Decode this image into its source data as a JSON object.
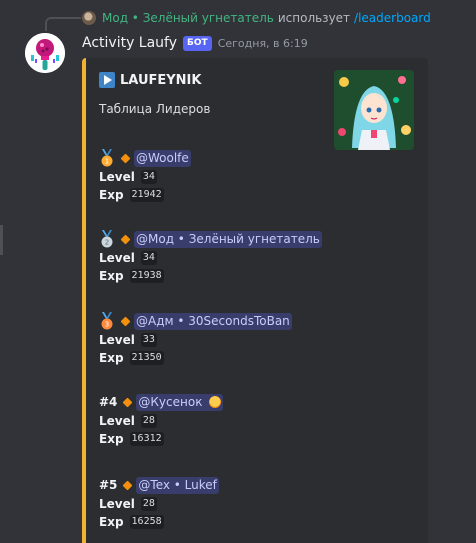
{
  "reply": {
    "user": "Мод • Зелёный угнетатель",
    "text": "использует",
    "command": "/leaderboard"
  },
  "message": {
    "author": "Activity Laufy",
    "badge": "БОТ",
    "timestamp": "Сегодня, в 6:19"
  },
  "embed": {
    "accent_color": "#f0b232",
    "author_icon": "play-button-icon",
    "author_name": "LAUFEYNIK",
    "description": "Таблица Лидеров",
    "entries": [
      {
        "rank_icon": "first-place-medal-icon",
        "rank": "",
        "user": "@Woolfe",
        "level": "34",
        "exp": "21942"
      },
      {
        "rank_icon": "second-place-medal-icon",
        "rank": "",
        "user": "@Мод • Зелёный угнетатель",
        "level": "34",
        "exp": "21938"
      },
      {
        "rank_icon": "third-place-medal-icon",
        "rank": "",
        "user": "@Адм • 30SecondsToBan",
        "level": "33",
        "exp": "21350"
      },
      {
        "rank_icon": "",
        "rank": "#4",
        "user": "@Кусенок",
        "level": "28",
        "exp": "16312"
      },
      {
        "rank_icon": "",
        "rank": "#5",
        "user": "@Tex • Lukef",
        "level": "28",
        "exp": "16258"
      }
    ],
    "level_label": "Level",
    "exp_label": "Exp"
  }
}
